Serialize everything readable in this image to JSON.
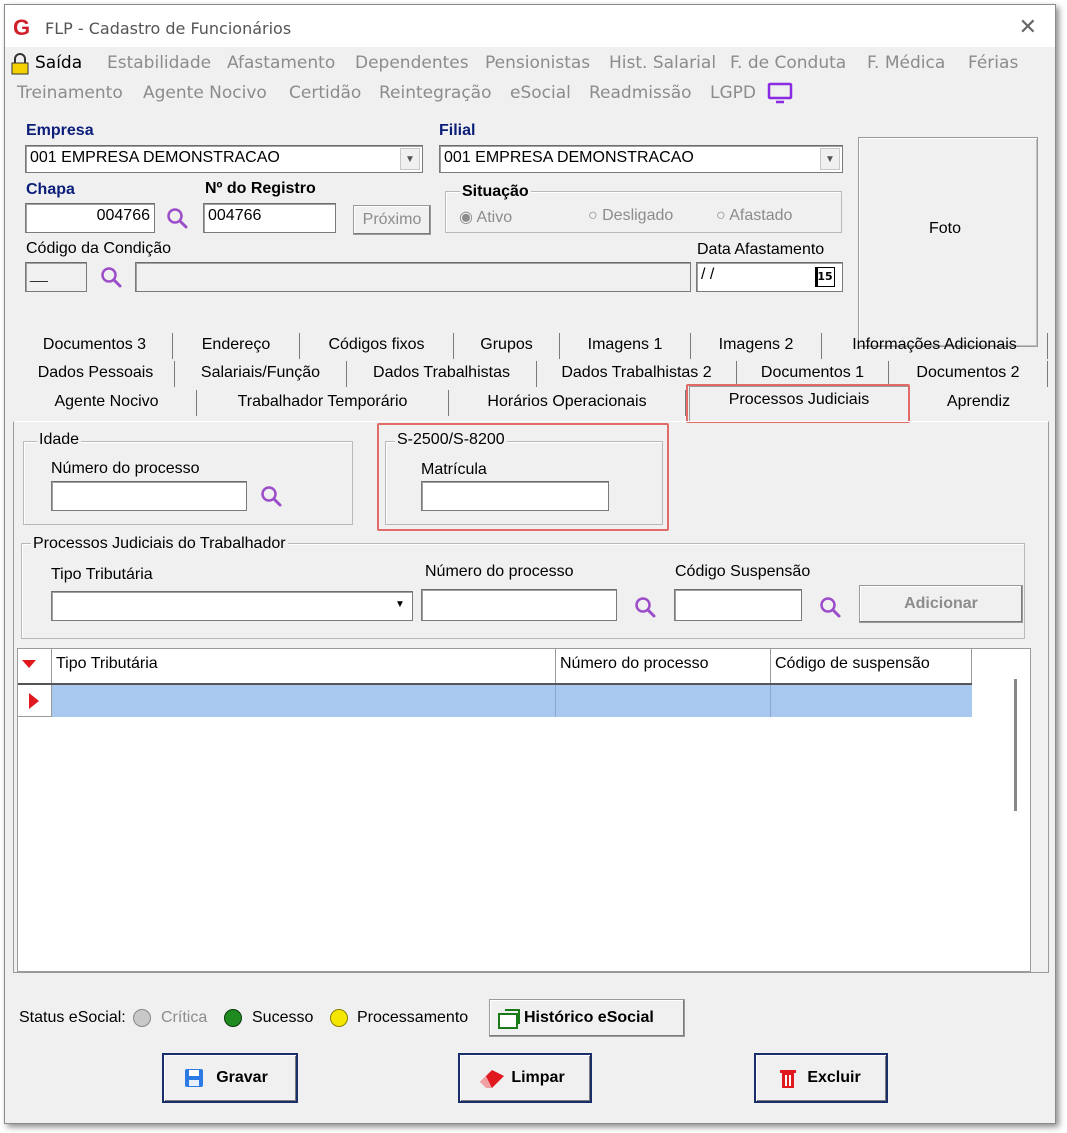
{
  "window": {
    "title": "FLP - Cadastro de Funcionários",
    "close_symbol": "✕"
  },
  "menu": {
    "row1": [
      "Saída",
      "Estabilidade",
      "Afastamento",
      "Dependentes",
      "Pensionistas",
      "Hist. Salarial",
      "F. de Conduta",
      "F. Médica",
      "Férias"
    ],
    "row2": [
      "Treinamento",
      "Agente Nocivo",
      "Certidão",
      "Reintegração",
      "eSocial",
      "Readmissão",
      "LGPD"
    ]
  },
  "header": {
    "empresa_label": "Empresa",
    "empresa_value": "001 EMPRESA DEMONSTRACAO",
    "filial_label": "Filial",
    "filial_value": "001 EMPRESA DEMONSTRACAO",
    "chapa_label": "Chapa",
    "chapa_value": "004766",
    "registro_label": "Nº do Registro",
    "registro_value": "004766",
    "proximo_label": "Próximo",
    "situacao_label": "Situação",
    "situacao_options": [
      "Ativo",
      "Desligado",
      "Afastado"
    ],
    "situacao_selected": "Ativo",
    "condicao_label": "Código da Condição",
    "condicao_code": "__",
    "data_afastamento_label": "Data Afastamento",
    "data_afastamento_value": "/ /",
    "calendar_day": "15",
    "foto_label": "Foto"
  },
  "tabs": {
    "row1": [
      "Documentos 3",
      "Endereço",
      "Códigos fixos",
      "Grupos",
      "Imagens 1",
      "Imagens 2",
      "Informações Adicionais"
    ],
    "row2": [
      "Dados Pessoais",
      "Salariais/Função",
      "Dados Trabalhistas",
      "Dados Trabalhistas 2",
      "Documentos 1",
      "Documentos 2"
    ],
    "row3": [
      "Agente Nocivo",
      "Trabalhador Temporário",
      "Horários Operacionais",
      "Processos Judiciais",
      "Aprendiz"
    ],
    "active": "Processos Judiciais"
  },
  "idade": {
    "group_title": "Idade",
    "numero_label": "Número do processo",
    "numero_value": ""
  },
  "s2500": {
    "group_title": "S-2500/S-8200",
    "matricula_label": "Matrícula",
    "matricula_value": ""
  },
  "processos": {
    "group_title": "Processos Judiciais do Trabalhador",
    "tipo_label": "Tipo Tributária",
    "tipo_value": "",
    "numero_label": "Número do processo",
    "numero_value": "",
    "codigo_label": "Código Suspensão",
    "codigo_value": "",
    "adicionar_label": "Adicionar"
  },
  "grid": {
    "columns": [
      "Tipo Tributária",
      "Número do processo",
      "Código de suspensão"
    ],
    "rows": [
      [
        "",
        "",
        ""
      ]
    ]
  },
  "status": {
    "label": "Status eSocial:",
    "critica": "Crítica",
    "sucesso": "Sucesso",
    "processamento": "Processamento",
    "historico_label": "Histórico eSocial",
    "colors": {
      "critica": "#c8c8c8",
      "sucesso": "#1f8a1f",
      "processamento": "#f5e600"
    }
  },
  "actions": {
    "gravar": "Gravar",
    "limpar": "Limpar",
    "excluir": "Excluir"
  }
}
